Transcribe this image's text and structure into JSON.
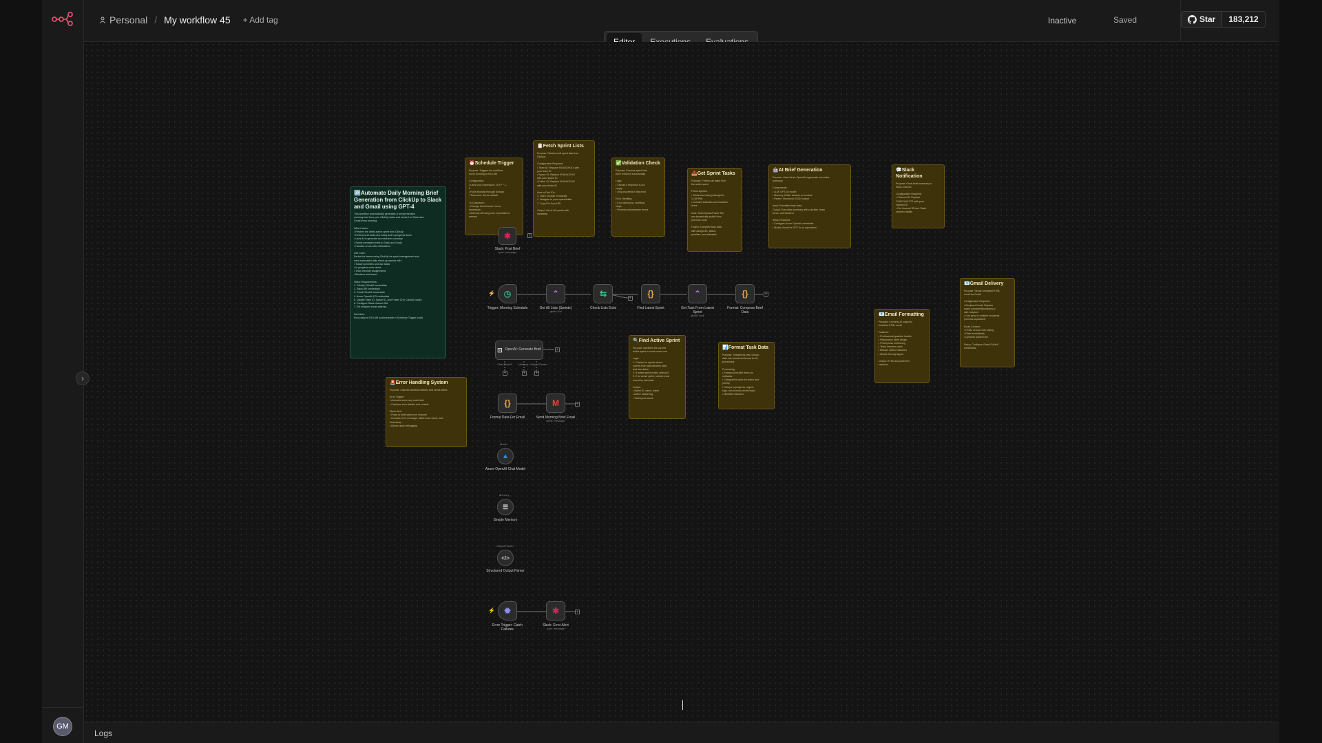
{
  "app": {
    "brand_color": "#EA4B71",
    "accent": "#FF6D5A"
  },
  "sidebar": {
    "avatar_initials": "GM"
  },
  "header": {
    "project": "Personal",
    "workflow_title": "My workflow 45",
    "add_tag": "+ Add tag",
    "status": "Inactive",
    "save_state": "Saved",
    "github_star": "Star",
    "github_count": "183,212"
  },
  "tabs": [
    {
      "label": "Editor",
      "active": true
    },
    {
      "label": "Executions",
      "active": false
    },
    {
      "label": "Evaluations",
      "active": false
    }
  ],
  "logs_label": "Logs",
  "notes": {
    "main": {
      "title": "🆙Automate Daily Morning Brief Generation from ClickUp to Slack and Gmail using GPT-4",
      "lines": [
        "This workflow automatically generates a comprehensive",
        "morning brief from your ClickUp tasks and sends it to Slack and",
        "Gmail every morning.",
        "",
        "What it does:",
        "• Fetches the latest active sprint from ClickUp",
        "• Retrieves all tasks due today and in-progress items",
        "• Uses AI to generate an executive summary",
        "• Sends formatted briefs to Slack and Gmail",
        "• Handles errors with notifications",
        "",
        "Use Case:",
        "Perfect for teams using ClickUp for sprint management who",
        "want automated daily stand-up reports with:",
        "• Today's priorities and due tasks",
        "• In-progress work status",
        "• Team member assignments",
        "• Blockers and issues",
        "",
        "Setup Requirements:",
        "1. ClickUp OAuth2 credentials",
        "2. Slack API credentials",
        "3. Gmail OAuth2 credentials",
        "4. Azure OpenAI API credentials",
        "5. Update Team ID, Space ID, and Folder ID in ClickUp nodes",
        "6. Configure Slack channel IDs",
        "7. Set recipient email address",
        "",
        "Schedule:",
        "Runs daily at 9:15 AM (customizable in Schedule Trigger node)"
      ]
    },
    "schedule": {
      "title": "⏰Schedule Trigger",
      "lines": [
        "Purpose: Triggers the workflow",
        "every morning at 9:15 AM",
        "",
        "Configuration:",
        "• Uses cron expression: 15 9 * * 1-",
        "5",
        "• Runs Monday through Sunday",
        "• Timezone: Server default",
        "",
        "To Customize:",
        "• Change hour/minute in cron",
        "  expression",
        "• Add day-off using cron expression if",
        "  needed"
      ]
    },
    "fetch": {
      "title": "📋Fetch Sprint Lists",
      "lines": [
        "Purpose: Retrieves all sprint lists from",
        "ClickUp",
        "",
        "Configuration Required:",
        "• Team ID: Replace 90160XXXXX with",
        "  your team ID",
        "• Space ID: Replace 90164XXXXX",
        "  with your space ID",
        "• Folder ID: Replace 90164XXXXX",
        "  with your folder ID",
        "",
        "How to Find IDs:",
        "1. Open ClickUp in browser",
        "2. Navigate to your space/folder",
        "3. Copy IDs from URL",
        "",
        "Output: List of all sprints with",
        "metadata"
      ]
    },
    "validation": {
      "title": "✅Validation Check",
      "lines": [
        "Purpose: Ensures sprint lists",
        "were retrieved successfully",
        "",
        "Logic:",
        "• Checks if response is not",
        "  empty",
        "• Only proceeds if lists exist",
        "",
        "Error Handling:",
        "• If no lists found, workflow",
        "  stops",
        "• Prevents downstream errors"
      ]
    },
    "get_tasks": {
      "title": "📥Get Sprint Tasks",
      "lines": [
        "Purpose: Fetches all tasks from",
        "the active sprint",
        "",
        "Filters Applied:",
        "• Tasks due today (midnight to",
        "  11:59 PM)",
        "• Includes subtasks and checklist",
        "  items",
        "",
        "Note: Team/Space/Folder IDs",
        "are dynamically pulled from",
        "previous node",
        "",
        "Output: Complete task data",
        "with assignees, status,",
        "priorities, and subtasks"
      ]
    },
    "ai_brief": {
      "title": "🤖AI Brief Generation",
      "lines": [
        "Purpose: Uses Azure OpenAI to generate executive",
        "summary",
        "",
        "Components:",
        "• LLM: GPT-4o model",
        "• Memory: Buffer window for context",
        "• Parser: Structured JSON output",
        "",
        "Input: Formatted task data",
        "Output: Executive summary with priorities, team",
        "focus, and blockers",
        "",
        "Setup Required:",
        "• Configure Azure OpenAI credentials",
        "• Model should be GPT-4o or equivalent"
      ]
    },
    "slack_notif": {
      "title": "💬Slack Notification",
      "lines": [
        "Purpose: Posts brief summary to",
        "Slack channel",
        "",
        "Configuration Required:",
        "• Channel ID: Replace",
        "  C09XXXXXXTS with your",
        "  channel ID",
        "• Get channel ID from Slack",
        "  channel details"
      ]
    },
    "gmail": {
      "title": "📧Gmail Delivery",
      "lines": [
        "Purpose: Sends formatted HTML",
        "email via Gmail",
        "",
        "Configuration Required:",
        "• Recipient Email: Replace",
        "  name.surname@company.io",
        "  with recipient",
        "• Can send to multiple recipients",
        "  (comma-separated)",
        "",
        "Email Content:",
        "• HTML version with styling",
        "• Plain text fallback",
        "• Dynamic subject line",
        "",
        "Setup: Configure Gmail OAuth2",
        "credentials"
      ]
    },
    "email_fmt": {
      "title": "📧Email Formatting",
      "lines": [
        "Purpose: Converts AI output to",
        "beautiful HTML email",
        "",
        "Features:",
        "• Professional gradient header",
        "• Responsive table design",
        "• Priority task numbering",
        "• Team member cards",
        "• Blocker status indicators",
        "• Mobile-friendly layout",
        "",
        "Output: HTML and plain text",
        "versions"
      ]
    },
    "find_sprint": {
      "title": "🔍Find Active Sprint",
      "lines": [
        "Purpose: Identifies the current",
        "active sprint or most recent one",
        "",
        "Logic:",
        "1. Checks for sprints where",
        "   current time falls between start",
        "   and due dates",
        "2. If active sprint exists, selects it",
        "3. If no active sprint, selects most",
        "   recent by start date",
        "",
        "Output:",
        "• Sprint ID, name, dates",
        "• Active status flag",
        "• Total sprint count"
      ]
    },
    "format_task": {
      "title": "📊Format Task Data",
      "lines": [
        "Purpose: Transforms raw ClickUp",
        "data into structured format for AI",
        "processing",
        "",
        "Processing:",
        "• Extracts checklist items as",
        "  subtasks",
        "• Categorizes tasks by status and",
        "  priority",
        "• Groups in-progress, urgent,",
        "  high, and normal priority tasks",
        "• Identifies blockers"
      ]
    },
    "error": {
      "title": "🚨Error Handling System",
      "lines": [
        "Purpose: Catches workflow failures and sends alerts",
        "",
        "Error Trigger:",
        "• Activates when any node fails",
        "• Captures error details and context",
        "",
        "Slack Alert:",
        "• Posts to dedicated error channel",
        "• Includes error message, failed node name, and",
        "  timestamp",
        "• Allows quick debugging"
      ]
    }
  },
  "nodes": {
    "slack_post": {
      "label": "Slack: Post Brief",
      "sub": "post: message"
    },
    "trigger": {
      "label": "Trigger: Morning Schedule"
    },
    "get_lists": {
      "label": "Get All Lists (Sprints)",
      "sub": "getAll: list"
    },
    "check_lists": {
      "label": "Check Lists Exist"
    },
    "find_latest": {
      "label": "Find Latest Sprint"
    },
    "get_task_latest": {
      "label": "Get Task From Latest Sprint",
      "sub": "getAll: task"
    },
    "format_compose": {
      "label": "Format: Compose Brief Data"
    },
    "openai_brief": {
      "label": "OpenAI: Generate Brief",
      "ports": [
        "Chat Model*",
        "Memory",
        "Output Parser"
      ]
    },
    "format_email": {
      "label": "Format Data For Email"
    },
    "send_email": {
      "label": "Send Morning Brief Email",
      "sub": "send: message"
    },
    "azure_model": {
      "label": "Azure OpenAI Chat Model",
      "top": "Model"
    },
    "memory": {
      "label": "Simple Memory",
      "top": "Memory"
    },
    "parser": {
      "label": "Structured Output Parser",
      "top": "Output Parser"
    },
    "error_trigger": {
      "label": "Error Trigger: Catch Failures"
    },
    "slack_error": {
      "label": "Slack: Error Alert",
      "sub": "post: message"
    }
  }
}
